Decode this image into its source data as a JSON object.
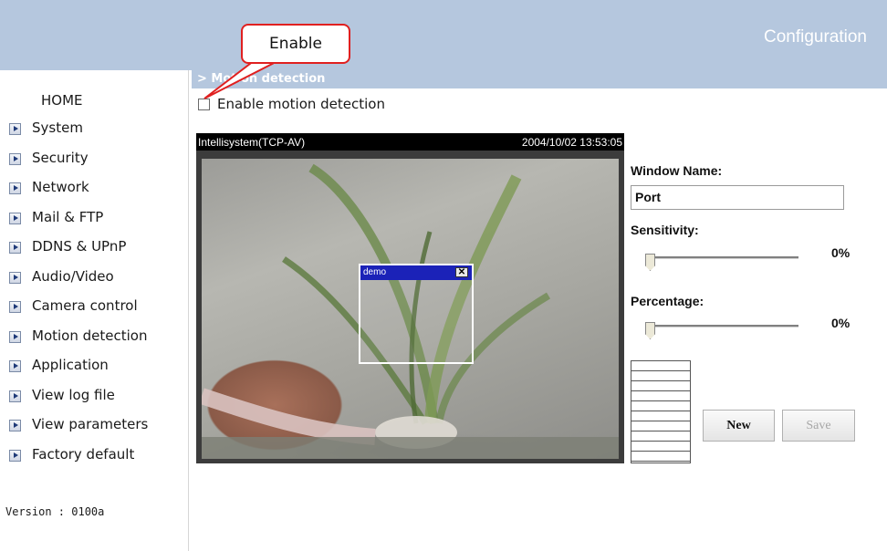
{
  "header": {
    "title": "Configuration"
  },
  "callout": {
    "text": "Enable"
  },
  "sidebar": {
    "home": "HOME",
    "items": [
      {
        "label": "System"
      },
      {
        "label": "Security"
      },
      {
        "label": "Network"
      },
      {
        "label": "Mail & FTP"
      },
      {
        "label": "DDNS & UPnP"
      },
      {
        "label": "Audio/Video"
      },
      {
        "label": "Camera control"
      },
      {
        "label": "Motion detection"
      },
      {
        "label": "Application"
      },
      {
        "label": "View log file"
      },
      {
        "label": "View parameters"
      },
      {
        "label": "Factory default"
      }
    ],
    "version": "Version : 0100a"
  },
  "main": {
    "section_title": "> Motion detection",
    "enable_label": "Enable motion detection",
    "enable_checked": false,
    "video": {
      "camera_name": "Intellisystem(TCP-AV)",
      "timestamp": "2004/10/02 13:53:05",
      "window_title": "demo",
      "close_glyph": "✕"
    },
    "window_name_label": "Window Name:",
    "window_name_value": "Port",
    "sensitivity_label": "Sensitivity:",
    "sensitivity_value": "0%",
    "percentage_label": "Percentage:",
    "percentage_value": "0%",
    "new_button": "New",
    "save_button": "Save"
  }
}
